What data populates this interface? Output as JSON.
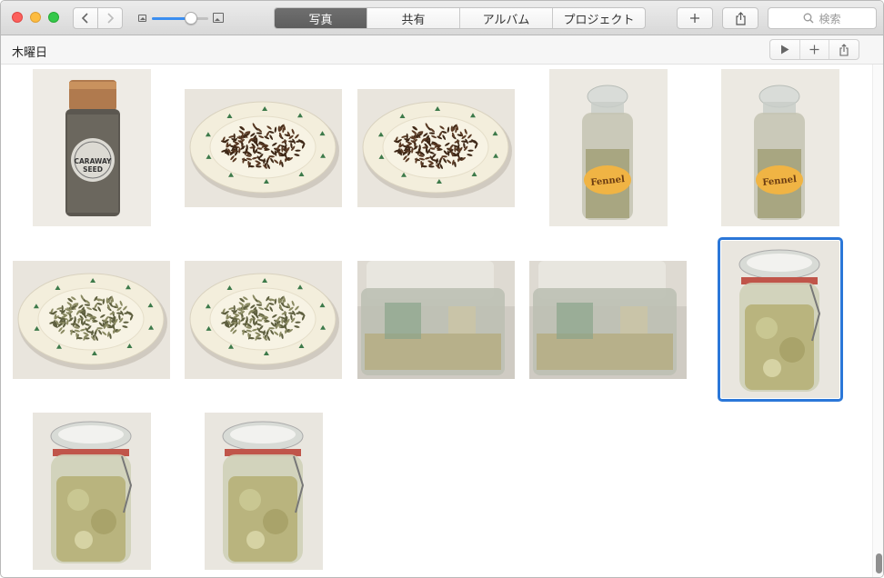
{
  "toolbar": {
    "tabs": [
      {
        "label": "写真",
        "active": true
      },
      {
        "label": "共有",
        "active": false
      },
      {
        "label": "アルバム",
        "active": false
      },
      {
        "label": "プロジェクト",
        "active": false
      }
    ],
    "search_placeholder": "検索",
    "zoom_level": 0.7
  },
  "header": {
    "title": "木曜日"
  },
  "photos": [
    {
      "subject": "caraway-seed-jar",
      "label_line1": "CARAWAY",
      "label_line2": "SEED",
      "selected": false
    },
    {
      "subject": "plate-caraway-seeds",
      "selected": false
    },
    {
      "subject": "plate-caraway-seeds",
      "selected": false
    },
    {
      "subject": "fennel-jar",
      "label_line1": "Fennel",
      "selected": false
    },
    {
      "subject": "fennel-jar",
      "label_line1": "Fennel",
      "selected": false
    },
    {
      "subject": "plate-fennel-seeds",
      "selected": false
    },
    {
      "subject": "plate-fennel-seeds",
      "selected": false
    },
    {
      "subject": "container-cabbage",
      "selected": false
    },
    {
      "subject": "container-cabbage",
      "selected": false
    },
    {
      "subject": "sauerkraut-jar",
      "selected": true
    },
    {
      "subject": "sauerkraut-jar",
      "selected": false
    },
    {
      "subject": "sauerkraut-jar",
      "selected": false
    }
  ],
  "colors": {
    "accent": "#2b77d8",
    "active_tab": "#666666"
  }
}
